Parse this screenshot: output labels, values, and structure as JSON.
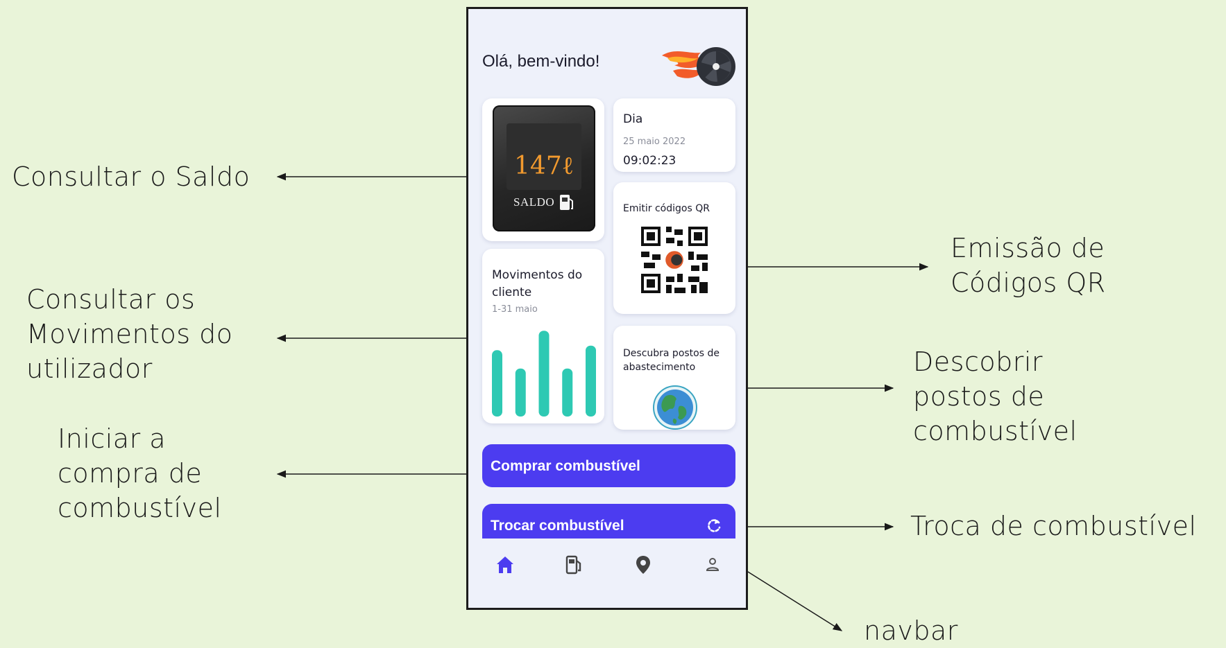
{
  "app": {
    "greeting": "Olá, bem-vindo!",
    "saldo": {
      "value": "147ℓ",
      "label": "SALDO"
    },
    "dia": {
      "title": "Dia",
      "date": "25 maio 2022",
      "time": "09:02:23"
    },
    "qr": {
      "title": "Emitir códigos QR"
    },
    "movimentos": {
      "title": "Movimentos do cliente",
      "range": "1-31 maio",
      "bars": [
        0.58,
        0.42,
        0.75,
        0.42,
        0.62
      ]
    },
    "postos": {
      "title": "Descubra postos de abastecimento"
    },
    "buttons": {
      "buy": "Comprar combustível",
      "trade": "Trocar combustível"
    },
    "navbar": {
      "items": [
        "home-icon",
        "fuel-pump-icon",
        "location-pin-icon",
        "user-icon"
      ],
      "active": 0
    },
    "colors": {
      "accent": "#4c3cf0",
      "bars": "#2ec9b3",
      "background": "#eef1fa",
      "page": "#e9f4d9"
    }
  },
  "annotations": {
    "saldo": "Consultar o Saldo",
    "movimentos": [
      "Consultar os",
      "Movimentos do",
      "utilizador"
    ],
    "compra": [
      "Iniciar a",
      "compra de",
      "combustível"
    ],
    "qr": [
      "Emissão de",
      "Códigos QR"
    ],
    "postos": [
      "Descobrir",
      "postos de",
      "combustível"
    ],
    "troca": "Troca de combustível",
    "navbar": "navbar"
  }
}
